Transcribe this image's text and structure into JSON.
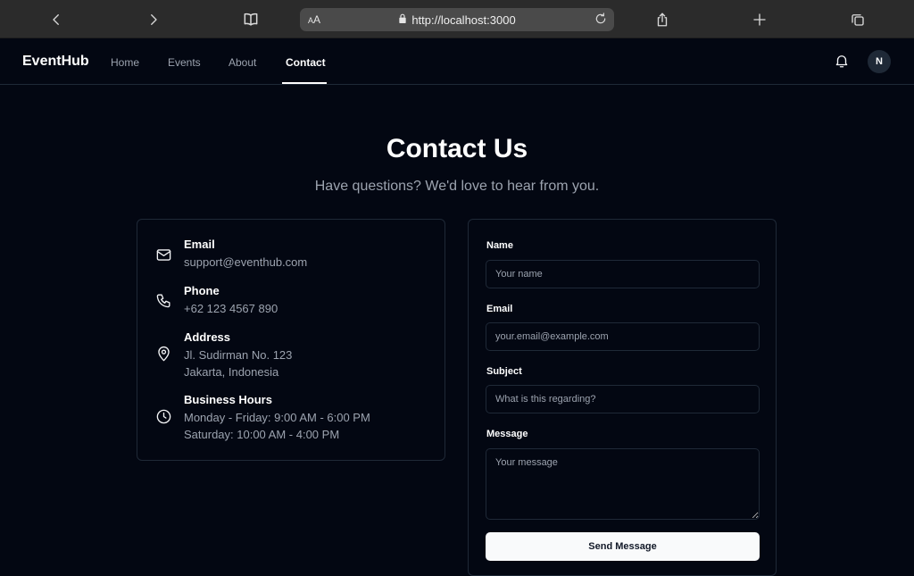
{
  "browser": {
    "text_size_label": "AA",
    "url": "http://localhost:3000"
  },
  "nav": {
    "brand": "EventHub",
    "links": [
      {
        "label": "Home"
      },
      {
        "label": "Events"
      },
      {
        "label": "About"
      },
      {
        "label": "Contact",
        "active": true
      }
    ],
    "avatar_initial": "N"
  },
  "header": {
    "title": "Contact Us",
    "subtitle": "Have questions? We'd love to hear from you."
  },
  "contact_info": [
    {
      "icon": "mail-icon",
      "label": "Email",
      "lines": [
        "support@eventhub.com"
      ]
    },
    {
      "icon": "phone-icon",
      "label": "Phone",
      "lines": [
        "+62 123 4567 890"
      ]
    },
    {
      "icon": "map-pin-icon",
      "label": "Address",
      "lines": [
        "Jl. Sudirman No. 123",
        "Jakarta, Indonesia"
      ]
    },
    {
      "icon": "clock-icon",
      "label": "Business Hours",
      "lines": [
        "Monday - Friday: 9:00 AM - 6:00 PM",
        "Saturday: 10:00 AM - 4:00 PM"
      ]
    }
  ],
  "form": {
    "name": {
      "label": "Name",
      "placeholder": "Your name",
      "value": ""
    },
    "email": {
      "label": "Email",
      "placeholder": "your.email@example.com",
      "value": ""
    },
    "subject": {
      "label": "Subject",
      "placeholder": "What is this regarding?",
      "value": ""
    },
    "message": {
      "label": "Message",
      "placeholder": "Your message",
      "value": ""
    },
    "submit_label": "Send Message"
  },
  "colors": {
    "background": "#030712",
    "border": "#1f2937",
    "muted_text": "#9ca3af",
    "button_bg": "#f9fafb"
  }
}
